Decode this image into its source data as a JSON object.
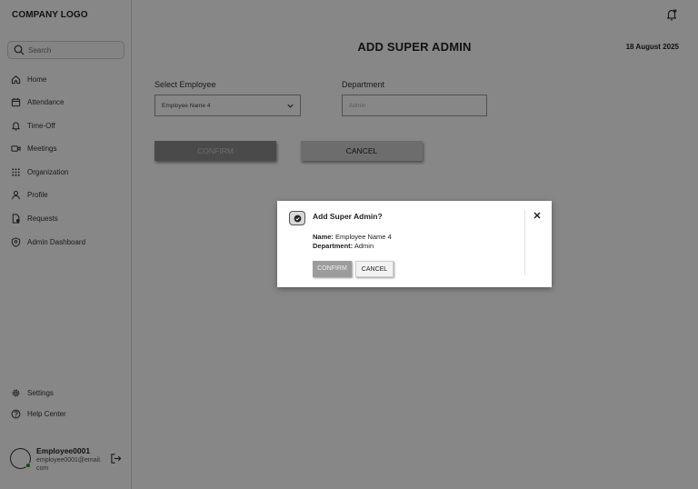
{
  "sidebar": {
    "logo": "COMPANY LOGO",
    "search_placeholder": "Search",
    "items": [
      {
        "label": "Home"
      },
      {
        "label": "Attendance"
      },
      {
        "label": "Time-Off"
      },
      {
        "label": "Meetings"
      },
      {
        "label": "Organization"
      },
      {
        "label": "Profile"
      },
      {
        "label": "Requests"
      },
      {
        "label": "Admin Dashboard"
      }
    ],
    "bottom_items": [
      {
        "label": "Settings"
      },
      {
        "label": "Help Center"
      }
    ],
    "user": {
      "name": "Employee0001",
      "email": "employee0001@email.com"
    }
  },
  "header": {
    "title": "ADD SUPER ADMIN",
    "date": "18 August 2025"
  },
  "form": {
    "employee_label": "Select Employee",
    "employee_value": "Employee Name 4",
    "department_label": "Department",
    "department_placeholder": "Admin",
    "confirm_label": "CONFIRM",
    "cancel_label": "CANCEL"
  },
  "modal": {
    "title": "Add Super Admin?",
    "name_key": "Name:",
    "name_value": "Employee Name 4",
    "dept_key": "Department:",
    "dept_value": "Admin",
    "confirm_label": "CONFIRM",
    "cancel_label": "CANCEL"
  },
  "colors": {
    "overlay": "#000000",
    "online": "#1e8a3a",
    "confirm_disabled": "#8d8d8d"
  }
}
